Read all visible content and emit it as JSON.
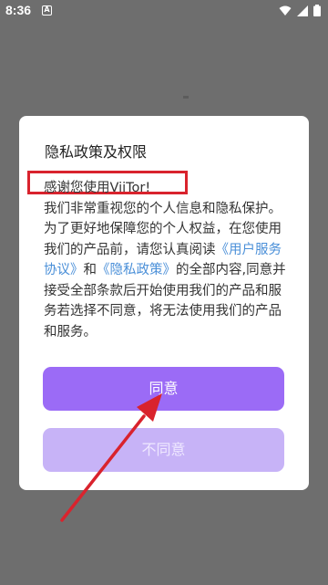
{
  "status_bar": {
    "time": "8:36",
    "notification_icon": "A",
    "icons": [
      "wifi-icon",
      "cellular-signal-icon",
      "battery-icon"
    ]
  },
  "dialog": {
    "title": "隐私政策及权限",
    "welcome": "感谢您使用ViiTor!",
    "body_part1": " 我们非常重视您的个人信息和隐私保护。为了更好地保障您的个人权益，在您使用我们的产品前，请您认真阅读",
    "link_user_agreement": "《用户服务协议》",
    "and": "和",
    "link_privacy_policy": "《隐私政策》",
    "body_part2": "的全部内容,同意并接受全部条款后开始使用我们的产品和服务若选择不同意，将无法使用我们的产品和服务。",
    "agree_label": "同意",
    "disagree_label": "不同意"
  },
  "colors": {
    "overlay_bg": "#6e6e6e",
    "agree_button": "#9b6bf6",
    "disagree_button": "#c7b3f7",
    "link": "#4a8fd8",
    "annotation_red": "#d9232d"
  }
}
